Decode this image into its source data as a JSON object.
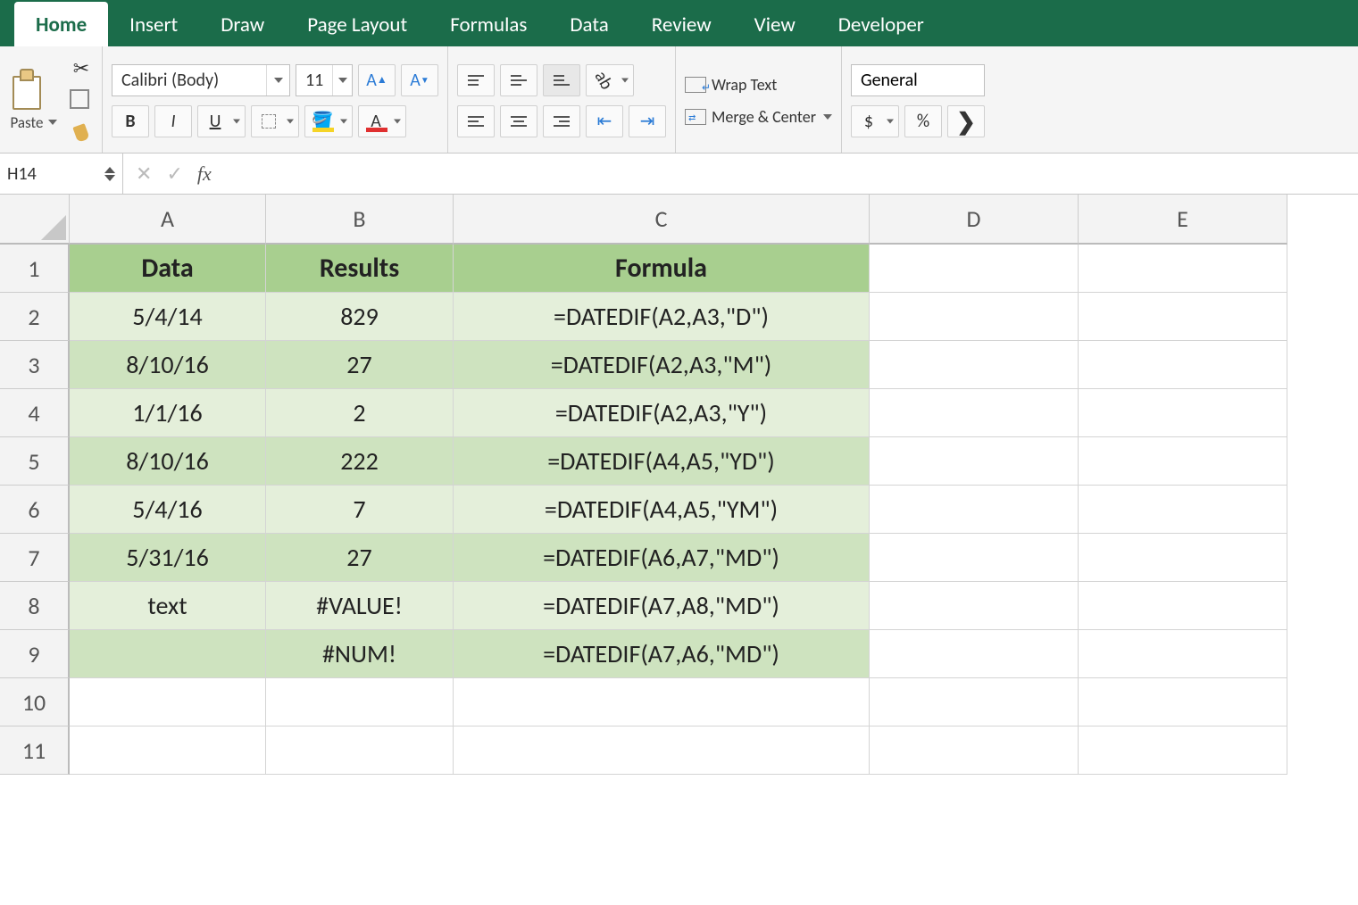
{
  "tabs": [
    "Home",
    "Insert",
    "Draw",
    "Page Layout",
    "Formulas",
    "Data",
    "Review",
    "View",
    "Developer"
  ],
  "active_tab": "Home",
  "ribbon": {
    "paste_label": "Paste",
    "font_name": "Calibri (Body)",
    "font_size": "11",
    "wrap_label": "Wrap Text",
    "merge_label": "Merge & Center",
    "number_format": "General",
    "currency_symbol": "$",
    "percent_symbol": "%"
  },
  "name_box": "H14",
  "formula_bar": "",
  "columns": [
    "A",
    "B",
    "C",
    "D",
    "E"
  ],
  "col_classes": [
    "cA",
    "cB",
    "cC",
    "cD",
    "cE"
  ],
  "rows": [
    {
      "n": "1",
      "band": "band-hdr",
      "hdr": true,
      "cells": [
        "Data",
        "Results",
        "Formula",
        "",
        ""
      ]
    },
    {
      "n": "2",
      "band": "band-lt",
      "cells": [
        "5/4/14",
        "829",
        "=DATEDIF(A2,A3,\"D\")",
        "",
        ""
      ]
    },
    {
      "n": "3",
      "band": "band-md",
      "cells": [
        "8/10/16",
        "27",
        "=DATEDIF(A2,A3,\"M\")",
        "",
        ""
      ]
    },
    {
      "n": "4",
      "band": "band-lt",
      "cells": [
        "1/1/16",
        "2",
        "=DATEDIF(A2,A3,\"Y\")",
        "",
        ""
      ]
    },
    {
      "n": "5",
      "band": "band-md",
      "cells": [
        "8/10/16",
        "222",
        "=DATEDIF(A4,A5,\"YD\")",
        "",
        ""
      ]
    },
    {
      "n": "6",
      "band": "band-lt",
      "cells": [
        "5/4/16",
        "7",
        "=DATEDIF(A4,A5,\"YM\")",
        "",
        ""
      ]
    },
    {
      "n": "7",
      "band": "band-md",
      "cells": [
        "5/31/16",
        "27",
        "=DATEDIF(A6,A7,\"MD\")",
        "",
        ""
      ]
    },
    {
      "n": "8",
      "band": "band-lt",
      "cells": [
        "text",
        "#VALUE!",
        "=DATEDIF(A7,A8,\"MD\")",
        "",
        ""
      ]
    },
    {
      "n": "9",
      "band": "band-md",
      "cells": [
        "",
        "#NUM!",
        "=DATEDIF(A7,A6,\"MD\")",
        "",
        ""
      ]
    },
    {
      "n": "10",
      "band": "",
      "cells": [
        "",
        "",
        "",
        "",
        ""
      ]
    },
    {
      "n": "11",
      "band": "",
      "cells": [
        "",
        "",
        "",
        "",
        ""
      ]
    }
  ]
}
